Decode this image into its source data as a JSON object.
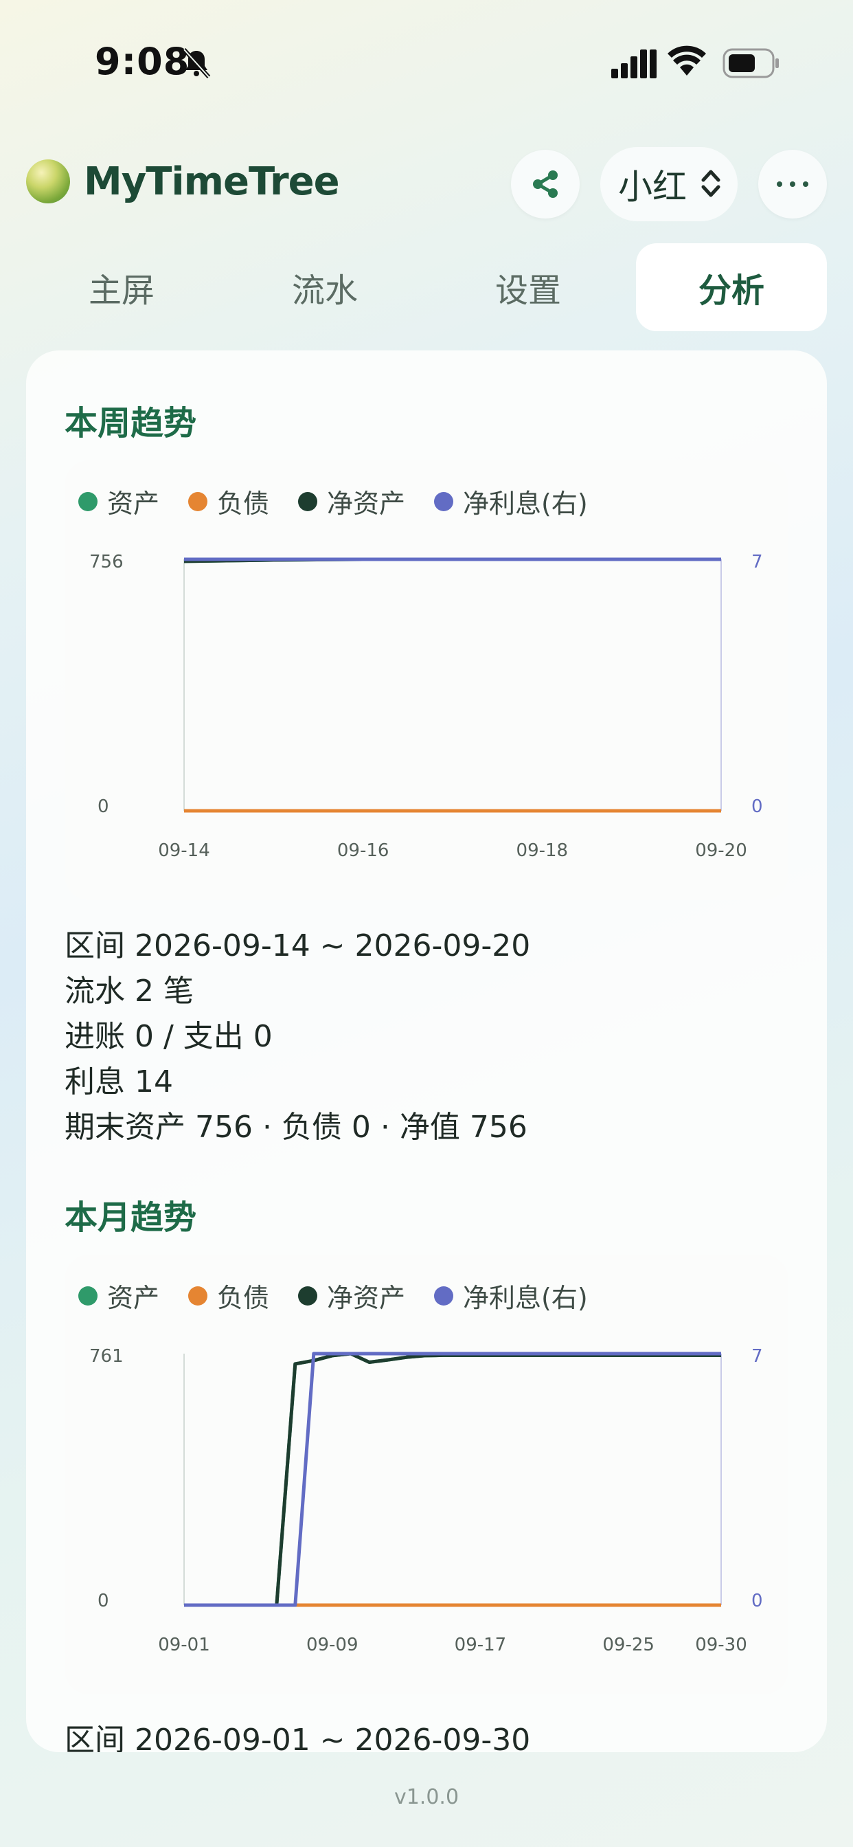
{
  "status": {
    "time": "9:08"
  },
  "app": {
    "title": "MyTimeTree",
    "user": "小红"
  },
  "icons": {
    "share": "share-icon",
    "more": "more-icon",
    "bell": "bell-slash-icon"
  },
  "tabs": [
    {
      "label": "主屏",
      "active": false
    },
    {
      "label": "流水",
      "active": false
    },
    {
      "label": "设置",
      "active": false
    },
    {
      "label": "分析",
      "active": true
    }
  ],
  "colors": {
    "asset": "#2f9a6a",
    "liability": "#e58532",
    "net": "#1d3d2f",
    "interest": "#626cc4"
  },
  "weekly": {
    "title": "本周趋势",
    "range": "区间 2026-09-14 ~ 2026-09-20",
    "count": "流水 2 笔",
    "flow": "进账 0 / 支出 0",
    "interest": "利息 14",
    "summary": "期末资产 756 · 负债 0 · 净值 756"
  },
  "monthly": {
    "title": "本月趋势",
    "range": "区间 2026-09-01 ~ 2026-09-30"
  },
  "version": "v1.0.0",
  "chart_data": [
    {
      "type": "line",
      "legend": [
        "资产",
        "负债",
        "净资产",
        "净利息(右)"
      ],
      "left_ticks": [
        "756",
        "0"
      ],
      "right_ticks": [
        "7",
        "0"
      ],
      "x_ticks": [
        "09-14",
        "09-16",
        "09-18",
        "09-20"
      ],
      "x": [
        "09-14",
        "09-15",
        "09-16",
        "09-17",
        "09-18",
        "09-19",
        "09-20"
      ],
      "ylim": [
        0,
        756
      ],
      "y2lim": [
        0,
        7
      ],
      "series": [
        {
          "name": "资产",
          "axis": "left",
          "values": [
            750,
            754,
            756,
            756,
            756,
            756,
            756
          ]
        },
        {
          "name": "负债",
          "axis": "left",
          "values": [
            0,
            0,
            0,
            0,
            0,
            0,
            0
          ]
        },
        {
          "name": "净资产",
          "axis": "left",
          "values": [
            750,
            754,
            756,
            756,
            756,
            756,
            756
          ]
        },
        {
          "name": "净利息(右)",
          "axis": "right",
          "values": [
            7,
            7,
            7,
            7,
            7,
            7,
            7
          ]
        }
      ]
    },
    {
      "type": "line",
      "legend": [
        "资产",
        "负债",
        "净资产",
        "净利息(右)"
      ],
      "left_ticks": [
        "761",
        "0"
      ],
      "right_ticks": [
        "7",
        "0"
      ],
      "x_ticks": [
        "09-01",
        "09-09",
        "09-17",
        "09-25",
        "09-30"
      ],
      "x": [
        "09-01",
        "09-02",
        "09-03",
        "09-04",
        "09-05",
        "09-06",
        "09-07",
        "09-08",
        "09-09",
        "09-10",
        "09-11",
        "09-12",
        "09-13",
        "09-14",
        "09-15",
        "09-16",
        "09-17",
        "09-18",
        "09-19",
        "09-20",
        "09-21",
        "09-22",
        "09-23",
        "09-24",
        "09-25",
        "09-26",
        "09-27",
        "09-28",
        "09-29",
        "09-30"
      ],
      "ylim": [
        0,
        761
      ],
      "y2lim": [
        0,
        7
      ],
      "series": [
        {
          "name": "资产",
          "axis": "left",
          "values": [
            0,
            0,
            0,
            0,
            0,
            0,
            730,
            740,
            755,
            761,
            735,
            742,
            750,
            755,
            756,
            756,
            756,
            756,
            756,
            756,
            756,
            756,
            756,
            756,
            756,
            756,
            756,
            756,
            756,
            756
          ]
        },
        {
          "name": "负债",
          "axis": "left",
          "values": [
            0,
            0,
            0,
            0,
            0,
            0,
            0,
            0,
            0,
            0,
            0,
            0,
            0,
            0,
            0,
            0,
            0,
            0,
            0,
            0,
            0,
            0,
            0,
            0,
            0,
            0,
            0,
            0,
            0,
            0
          ]
        },
        {
          "name": "净资产",
          "axis": "left",
          "values": [
            0,
            0,
            0,
            0,
            0,
            0,
            730,
            740,
            755,
            761,
            735,
            742,
            750,
            755,
            756,
            756,
            756,
            756,
            756,
            756,
            756,
            756,
            756,
            756,
            756,
            756,
            756,
            756,
            756,
            756
          ]
        },
        {
          "name": "净利息(右)",
          "axis": "right",
          "values": [
            0,
            0,
            0,
            0,
            0,
            0,
            0,
            7,
            7,
            7,
            7,
            7,
            7,
            7,
            7,
            7,
            7,
            7,
            7,
            7,
            7,
            7,
            7,
            7,
            7,
            7,
            7,
            7,
            7,
            7
          ]
        }
      ]
    }
  ]
}
